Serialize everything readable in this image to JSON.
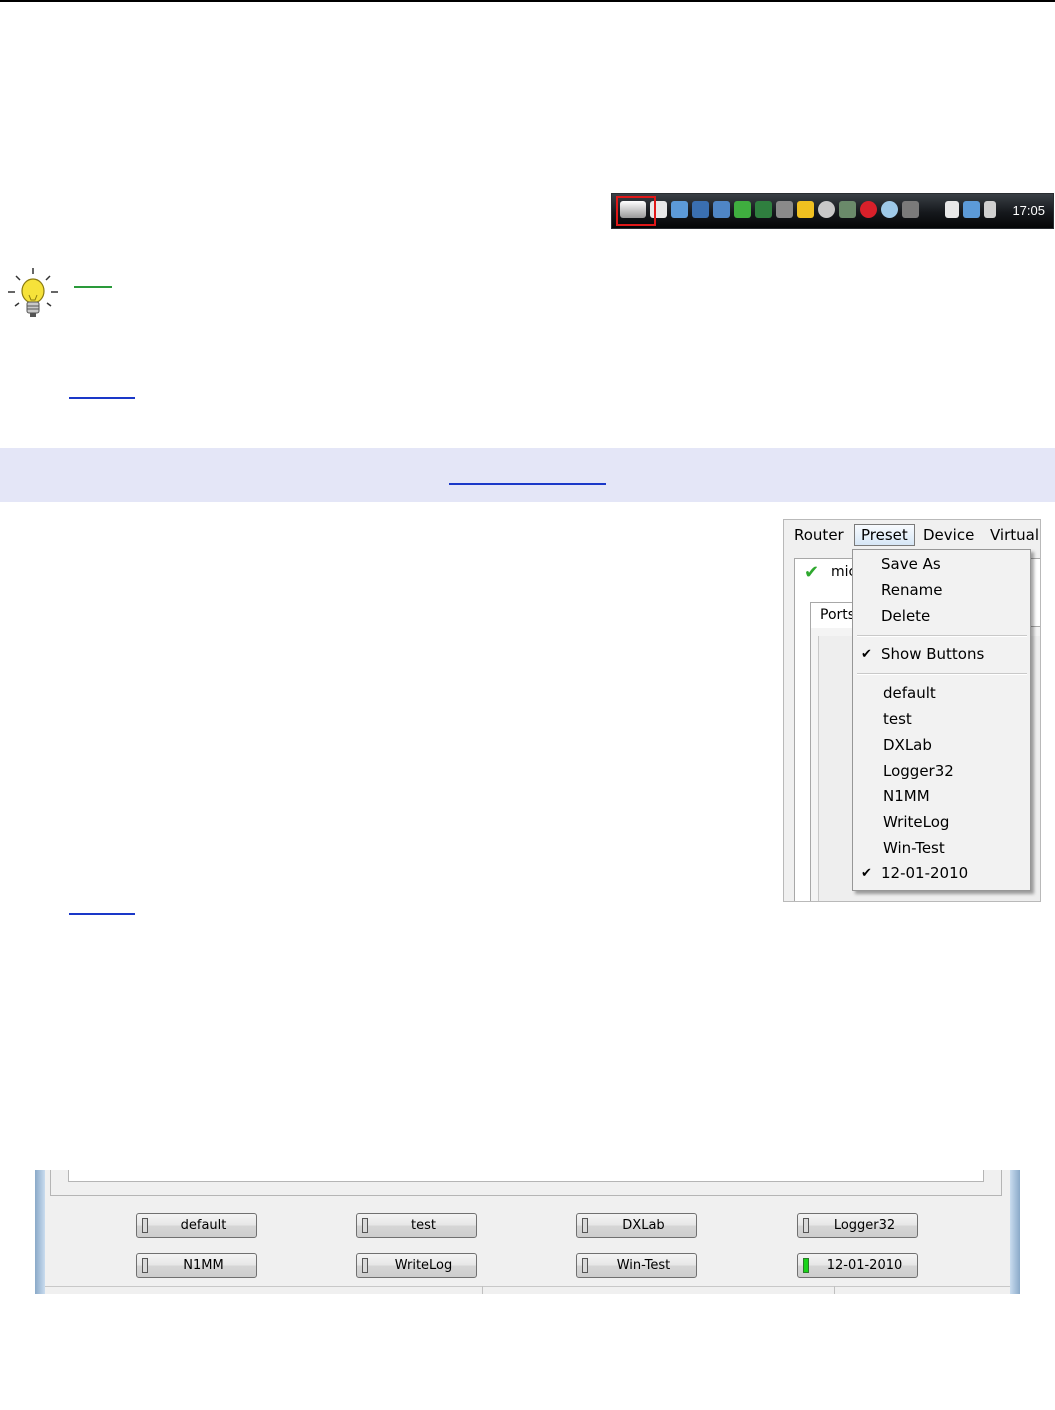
{
  "taskbar": {
    "clock": "17:05",
    "icons": [
      "virtual-serial-port-icon",
      "mail-icon",
      "network-icon",
      "monitor-icon",
      "folder-icon",
      "shield-icon",
      "network-drive-icon",
      "wireless-icon",
      "pen-icon",
      "disk-icon",
      "sound-icon",
      "opera-icon",
      "gear-icon",
      "ram-icon",
      "power-icon",
      "network-status-icon",
      "volume-icon"
    ]
  },
  "menu_screenshot": {
    "menubar": {
      "router": "Router",
      "preset": "Preset",
      "device": "Device",
      "virtual": "Virtual"
    },
    "behind_text": "mic",
    "ports_tab": "Ports",
    "preset_menu": {
      "save_as": "Save As",
      "rename": "Rename",
      "delete": "Delete",
      "show_buttons": "Show Buttons",
      "presets": [
        "default",
        "test",
        "DXLab",
        "Logger32",
        "N1MM",
        "WriteLog",
        "Win-Test",
        "12-01-2010"
      ],
      "checked_preset": "12-01-2010"
    }
  },
  "preset_buttons": [
    {
      "label": "default",
      "active": false
    },
    {
      "label": "test",
      "active": false
    },
    {
      "label": "DXLab",
      "active": false
    },
    {
      "label": "Logger32",
      "active": false
    },
    {
      "label": "N1MM",
      "active": false
    },
    {
      "label": "WriteLog",
      "active": false
    },
    {
      "label": "Win-Test",
      "active": false
    },
    {
      "label": "12-01-2010",
      "active": true
    }
  ],
  "colors": {
    "band": "#e4e6f7",
    "link": "#1a38c8",
    "tip_link": "#2a9a3a",
    "led_active": "#19d319",
    "tray_highlight": "#e01818"
  }
}
